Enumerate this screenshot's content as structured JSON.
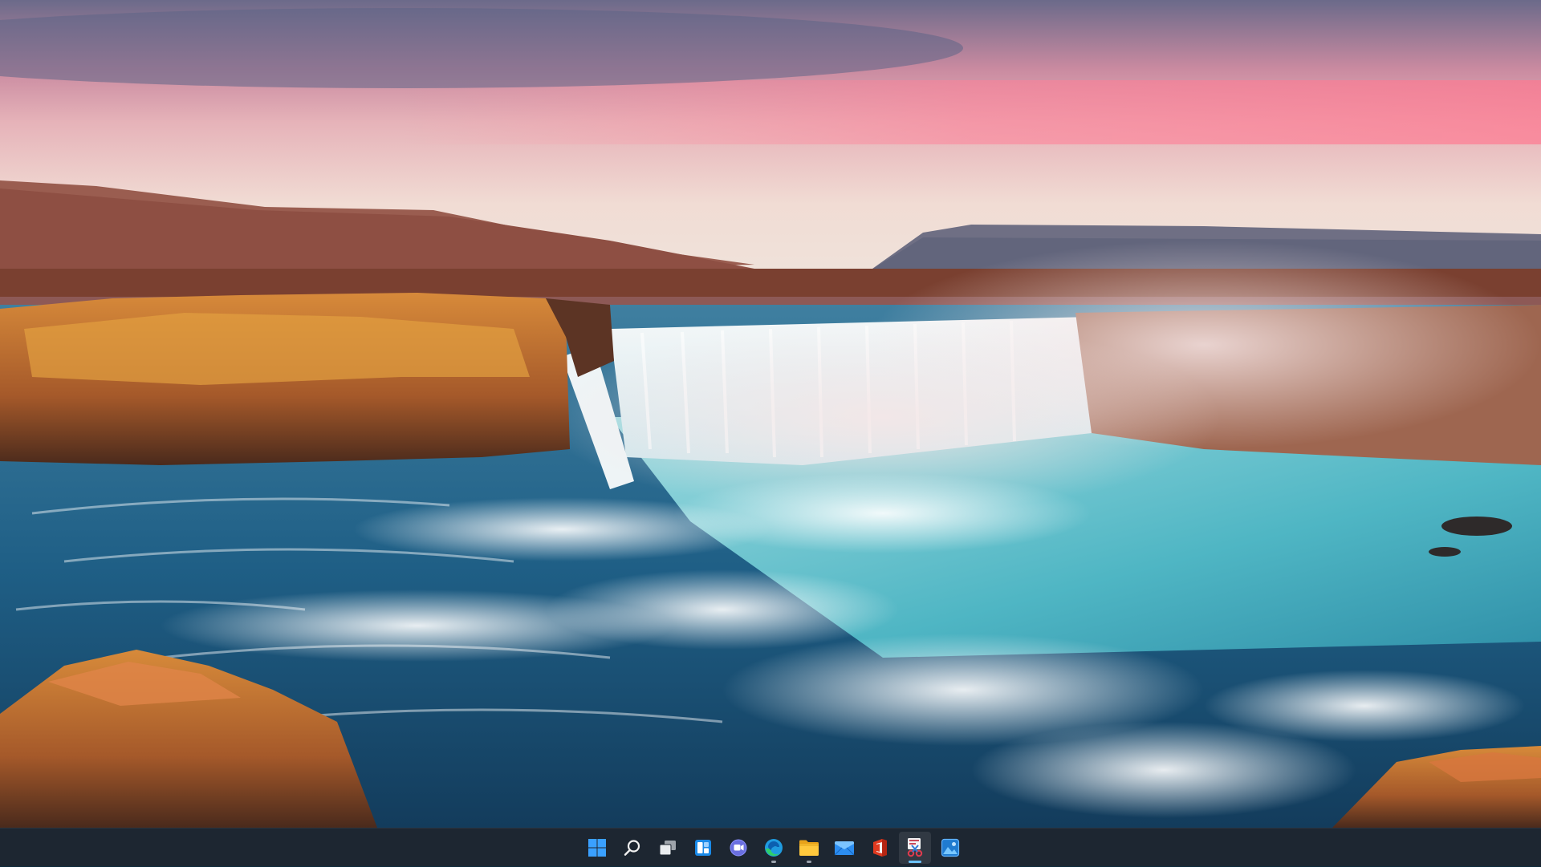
{
  "desktop": {
    "wallpaper": "waterfall-sunset-landscape"
  },
  "taskbar": {
    "background": "#1d2631",
    "accent": "#6cc3ff",
    "items": [
      {
        "id": "start",
        "icon": "windows-logo-icon",
        "running": false,
        "active": false
      },
      {
        "id": "search",
        "icon": "search-icon",
        "running": false,
        "active": false
      },
      {
        "id": "task-view",
        "icon": "task-view-icon",
        "running": false,
        "active": false
      },
      {
        "id": "widgets",
        "icon": "widgets-icon",
        "running": false,
        "active": false
      },
      {
        "id": "teams-chat",
        "icon": "teams-chat-icon",
        "running": false,
        "active": false
      },
      {
        "id": "edge",
        "icon": "edge-icon",
        "running": true,
        "active": false
      },
      {
        "id": "file-explorer",
        "icon": "folder-icon",
        "running": true,
        "active": false
      },
      {
        "id": "mail",
        "icon": "mail-icon",
        "running": false,
        "active": false
      },
      {
        "id": "office",
        "icon": "office-icon",
        "running": false,
        "active": false
      },
      {
        "id": "snipping-tool",
        "icon": "snipping-tool-icon",
        "running": true,
        "active": true
      },
      {
        "id": "photos",
        "icon": "photos-icon",
        "running": false,
        "active": false
      }
    ]
  }
}
